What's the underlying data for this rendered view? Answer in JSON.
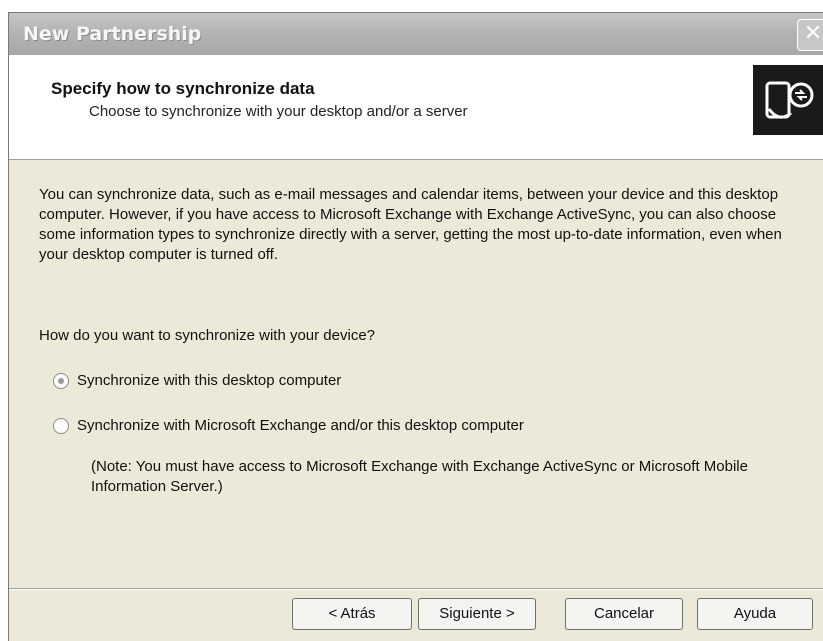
{
  "window": {
    "title": "New Partnership",
    "close_glyph": "✕"
  },
  "header": {
    "title": "Specify how to synchronize data",
    "subtitle": "Choose to synchronize with your desktop and/or a server",
    "icon": "sync-partnership-icon"
  },
  "body": {
    "description": "You can synchronize data, such as e-mail messages and calendar items, between your device and this desktop computer.  However, if you have access to Microsoft Exchange with Exchange ActiveSync, you can also choose some information types to synchronize directly with a server, getting the most up-to-date information, even when your desktop computer is turned off.",
    "question": "How do you want to synchronize with your device?"
  },
  "options": [
    {
      "label": "Synchronize with this desktop computer",
      "selected": true
    },
    {
      "label": "Synchronize with Microsoft Exchange and/or this desktop computer",
      "selected": false
    }
  ],
  "note": "(Note: You must have access to Microsoft Exchange with Exchange ActiveSync or Microsoft Mobile Information Server.)",
  "buttons": {
    "back": "< Atrás",
    "next": "Siguiente >",
    "cancel": "Cancelar",
    "help": "Ayuda"
  }
}
